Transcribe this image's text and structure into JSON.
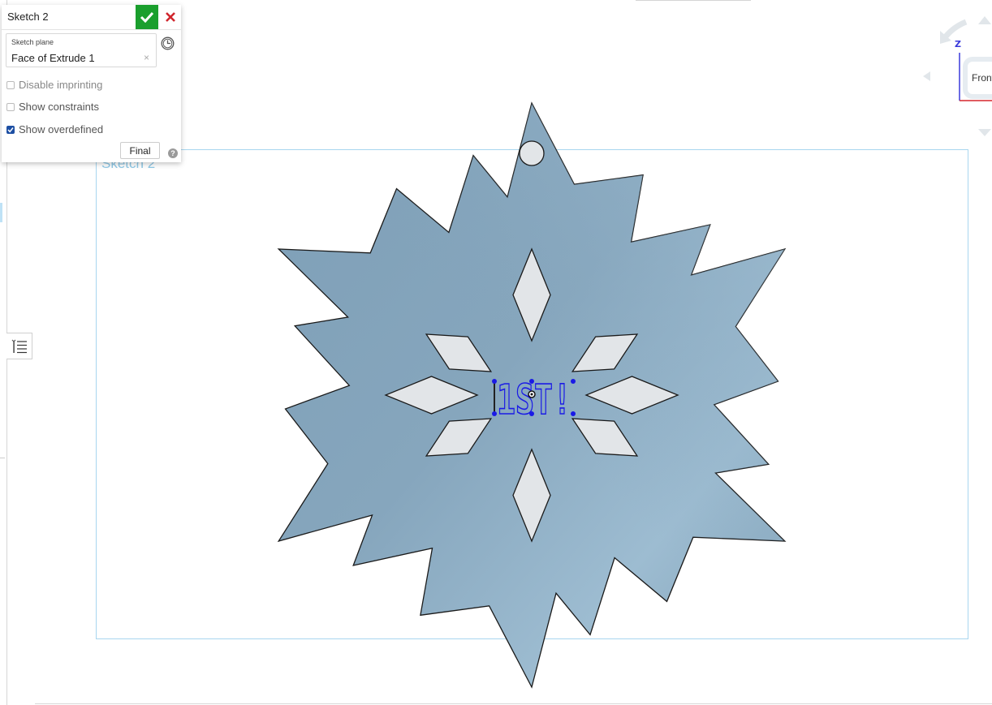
{
  "dialog": {
    "title": "Sketch 2",
    "confirm_icon": "checkmark-icon",
    "cancel_icon": "close-icon",
    "sketch_plane_label": "Sketch plane",
    "sketch_plane_value": "Face of Extrude 1",
    "history_icon": "clock-icon",
    "options": [
      {
        "label": "Disable imprinting",
        "checked": false,
        "disabled": true
      },
      {
        "label": "Show constraints",
        "checked": false,
        "disabled": false
      },
      {
        "label": "Show overdefined",
        "checked": true,
        "disabled": false
      }
    ],
    "final_label": "Final",
    "help_icon": "question-icon"
  },
  "viewport": {
    "sketch_label": "Sketch 2",
    "sketch_text": "1ST!",
    "colors": {
      "part_fill": "#86a6bd",
      "hole_fill": "#e2e5e8",
      "sketch_box": "#9fd3ef",
      "sketch_entity": "#1a1ae6"
    }
  },
  "view_cube": {
    "face_label": "Front",
    "axis_label": "Z"
  },
  "sidebar": {
    "list_icon": "feature-list-icon"
  }
}
